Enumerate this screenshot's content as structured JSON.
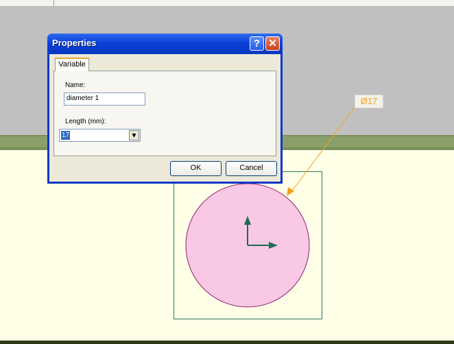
{
  "dialog": {
    "title": "Properties",
    "help_button": "?",
    "close_button": "✕",
    "tab_label": "Variable",
    "name_label": "Name:",
    "name_value": "diameter 1",
    "length_label": "Length (mm):",
    "length_value": "17",
    "ok_label": "OK",
    "cancel_label": "Cancel"
  },
  "drawing": {
    "dimension_label": "Ø17",
    "circle_fill": "#f9c8e4",
    "circle_stroke": "#8a1f6a",
    "bbox_color": "#2a7a58",
    "axis_color": "#1a6b52",
    "leader_color": "#f2a11c"
  },
  "colors": {
    "title_bar": "#0a40d8",
    "canvas_bg": "#ffffe8",
    "workspace_gray": "#c0c0c0",
    "green_band": "#7b8f5b"
  }
}
